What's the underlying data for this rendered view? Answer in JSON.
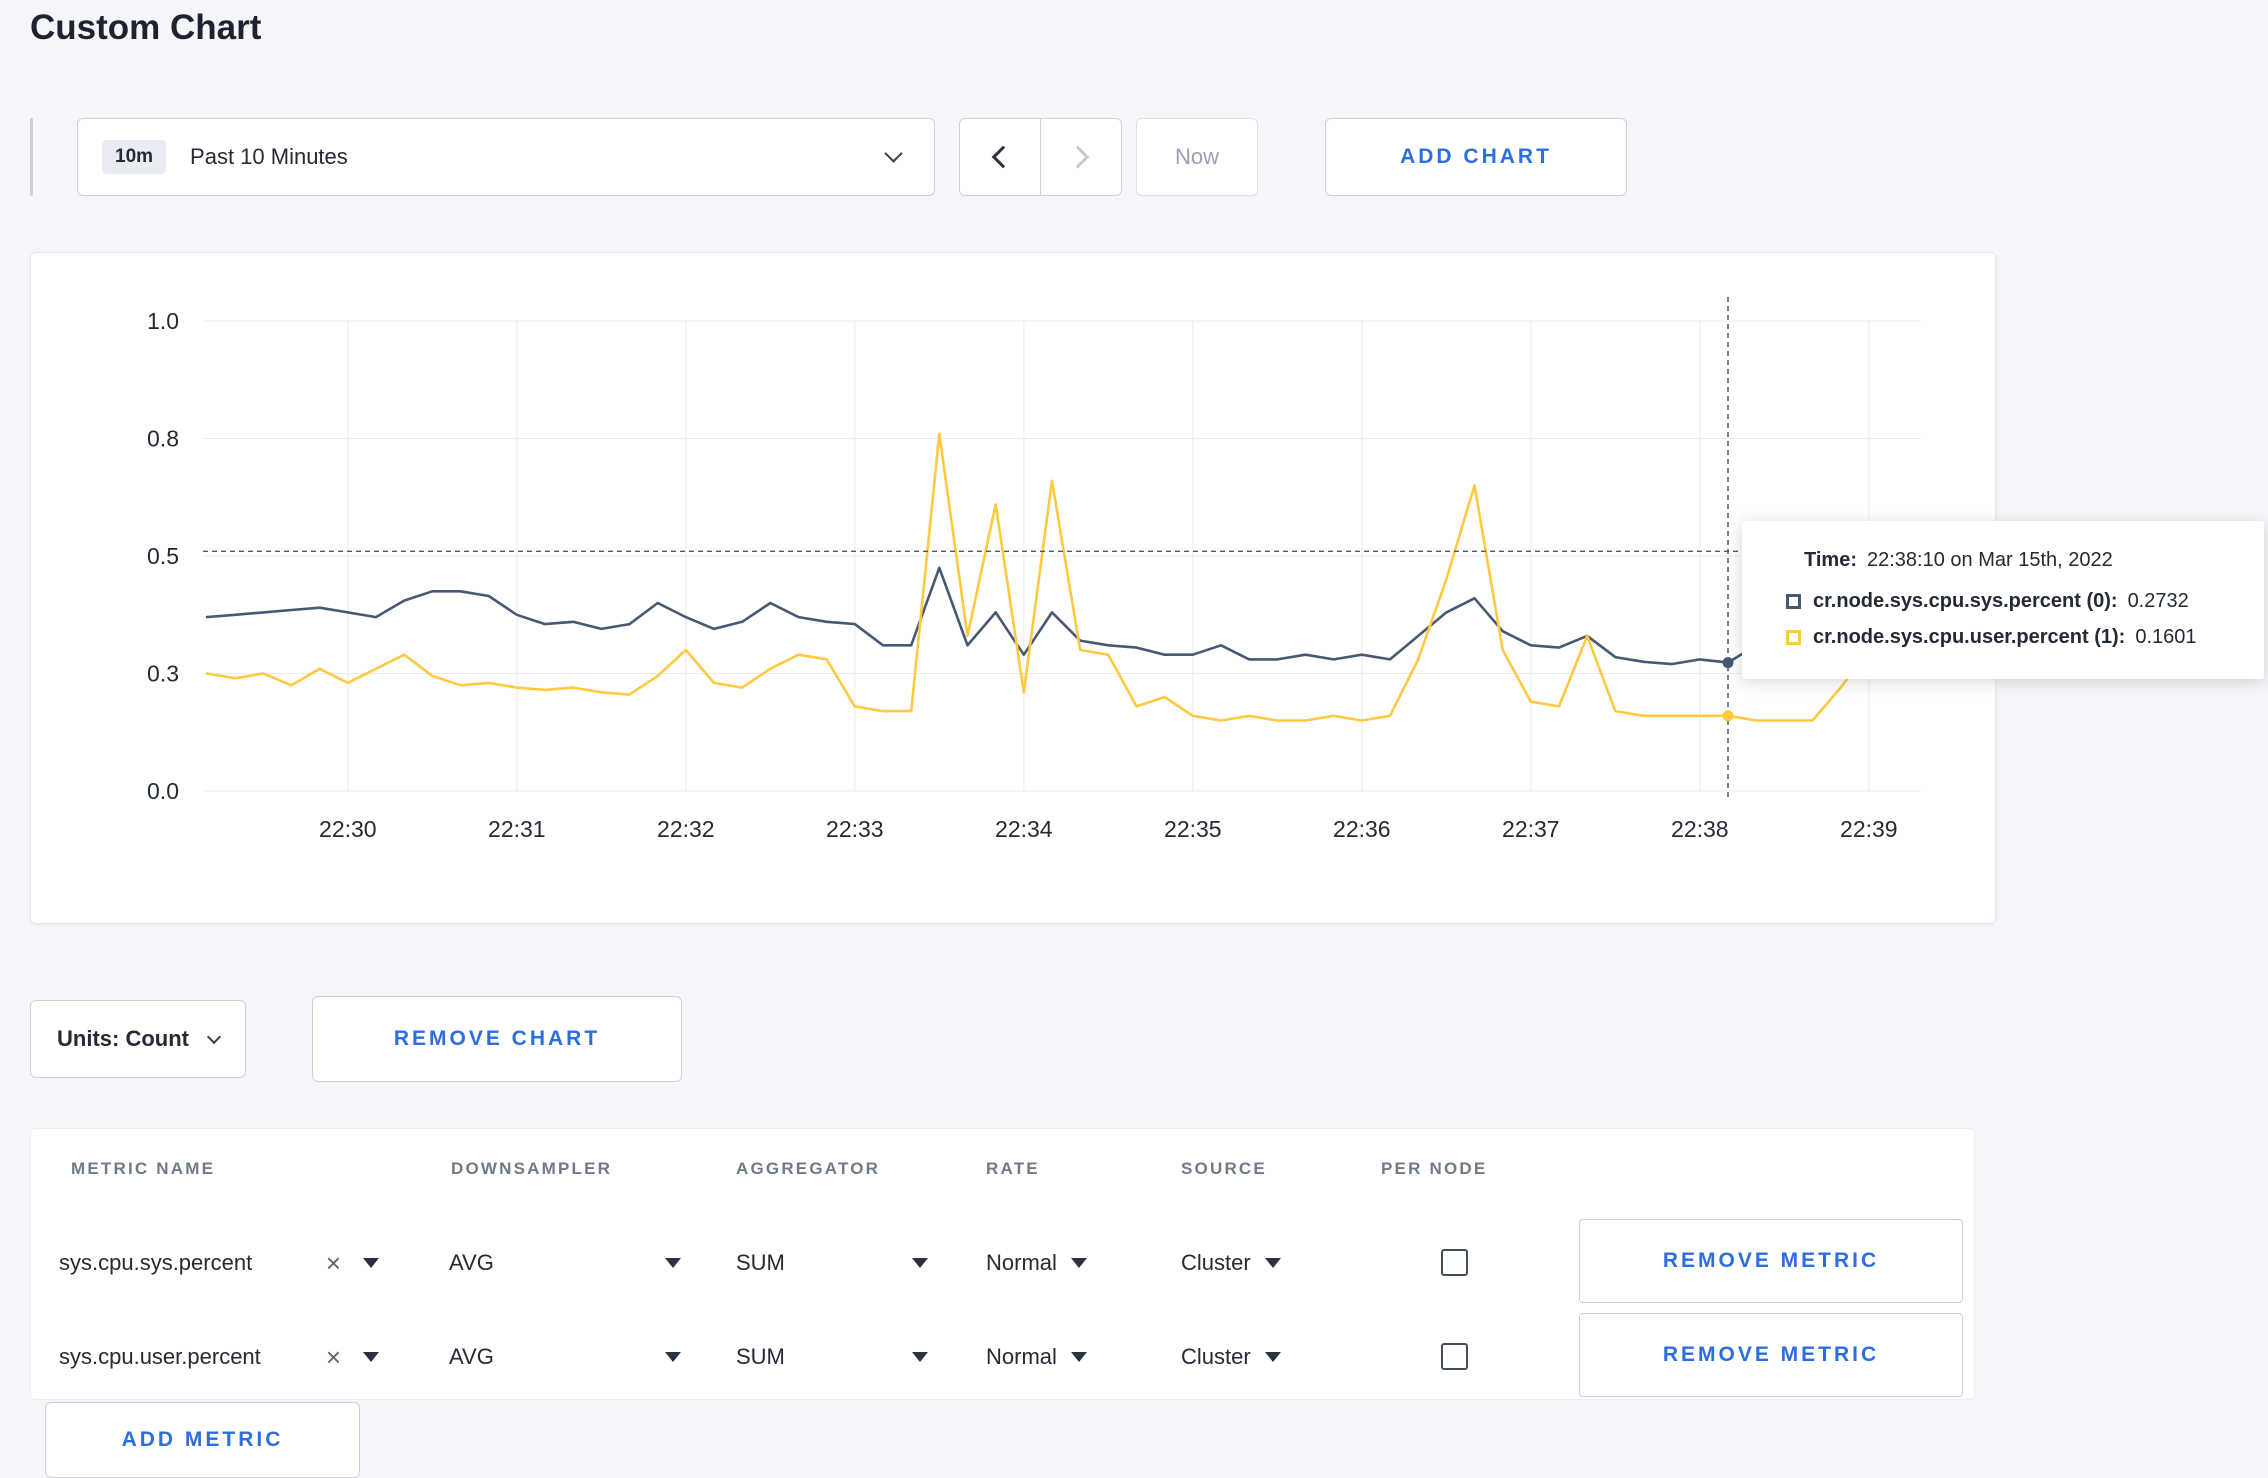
{
  "page": {
    "title": "Custom Chart"
  },
  "colors": {
    "accent": "#2d6edf",
    "series_sys": "#475872",
    "series_user": "#ffc940"
  },
  "icons": {
    "remove_token": "×"
  },
  "toolbar": {
    "time_badge": "10m",
    "time_label": "Past 10 Minutes",
    "now_label": "Now",
    "add_chart_label": "ADD CHART"
  },
  "chart_controls": {
    "units_label": "Units: Count",
    "remove_chart_label": "REMOVE CHART",
    "add_metric_label": "ADD METRIC"
  },
  "tooltip": {
    "time_label": "Time:",
    "time_value": "22:38:10 on Mar 15th, 2022",
    "series": [
      {
        "label": "cr.node.sys.cpu.sys.percent (0):",
        "value": "0.2732",
        "color": "#475872"
      },
      {
        "label": "cr.node.sys.cpu.user.percent (1):",
        "value": "0.1601",
        "color": "#ffc940"
      }
    ]
  },
  "table": {
    "headers": [
      "METRIC NAME",
      "DOWNSAMPLER",
      "AGGREGATOR",
      "RATE",
      "SOURCE",
      "PER NODE"
    ],
    "rows": [
      {
        "metric": "sys.cpu.sys.percent",
        "downsampler": "AVG",
        "aggregator": "SUM",
        "rate": "Normal",
        "source": "Cluster",
        "per_node": false,
        "remove_label": "REMOVE METRIC"
      },
      {
        "metric": "sys.cpu.user.percent",
        "downsampler": "AVG",
        "aggregator": "SUM",
        "rate": "Normal",
        "source": "Cluster",
        "per_node": false,
        "remove_label": "REMOVE METRIC"
      }
    ]
  },
  "chart_data": {
    "type": "line",
    "title": "Custom Chart",
    "grid": true,
    "legend_position": "tooltip",
    "x_axis": {
      "tick_labels": [
        "22:30",
        "22:31",
        "22:32",
        "22:33",
        "22:34",
        "22:35",
        "22:36",
        "22:37",
        "22:38",
        "22:39"
      ]
    },
    "y_axis": {
      "range": [
        0,
        1
      ],
      "tick_values": [
        1.0,
        0.75,
        0.5,
        0.25,
        0.0
      ],
      "tick_labels": [
        "1.0",
        "0.8",
        "0.5",
        "0.3",
        "0.0"
      ]
    },
    "start_time": "22:29:10",
    "interval_seconds": 10,
    "series": [
      {
        "name": "cr.node.sys.cpu.sys.percent",
        "color": "#475872",
        "values": [
          0.37,
          0.375,
          0.38,
          0.385,
          0.39,
          0.38,
          0.37,
          0.405,
          0.425,
          0.425,
          0.415,
          0.375,
          0.355,
          0.36,
          0.345,
          0.355,
          0.4,
          0.37,
          0.345,
          0.36,
          0.4,
          0.37,
          0.36,
          0.355,
          0.31,
          0.31,
          0.475,
          0.31,
          0.38,
          0.29,
          0.38,
          0.32,
          0.31,
          0.305,
          0.29,
          0.29,
          0.31,
          0.28,
          0.28,
          0.29,
          0.28,
          0.29,
          0.28,
          0.33,
          0.38,
          0.41,
          0.34,
          0.31,
          0.305,
          0.33,
          0.285,
          0.275,
          0.27,
          0.28,
          0.2732,
          0.31,
          0.32,
          0.3,
          0.3,
          0.31,
          0.3
        ]
      },
      {
        "name": "cr.node.sys.cpu.user.percent",
        "color": "#ffc940",
        "values": [
          0.25,
          0.24,
          0.25,
          0.225,
          0.26,
          0.23,
          0.26,
          0.29,
          0.245,
          0.225,
          0.23,
          0.22,
          0.215,
          0.22,
          0.21,
          0.205,
          0.245,
          0.3,
          0.23,
          0.22,
          0.26,
          0.29,
          0.28,
          0.18,
          0.17,
          0.17,
          0.76,
          0.33,
          0.61,
          0.21,
          0.66,
          0.3,
          0.29,
          0.18,
          0.2,
          0.16,
          0.15,
          0.16,
          0.15,
          0.15,
          0.16,
          0.15,
          0.16,
          0.28,
          0.45,
          0.65,
          0.3,
          0.19,
          0.18,
          0.33,
          0.17,
          0.16,
          0.16,
          0.16,
          0.1601,
          0.15,
          0.15,
          0.15,
          0.22,
          0.3,
          0.26
        ]
      }
    ],
    "crosshair": {
      "time": "22:38:10",
      "hline_value": 0.51,
      "values": [
        0.2732,
        0.1601
      ]
    }
  }
}
